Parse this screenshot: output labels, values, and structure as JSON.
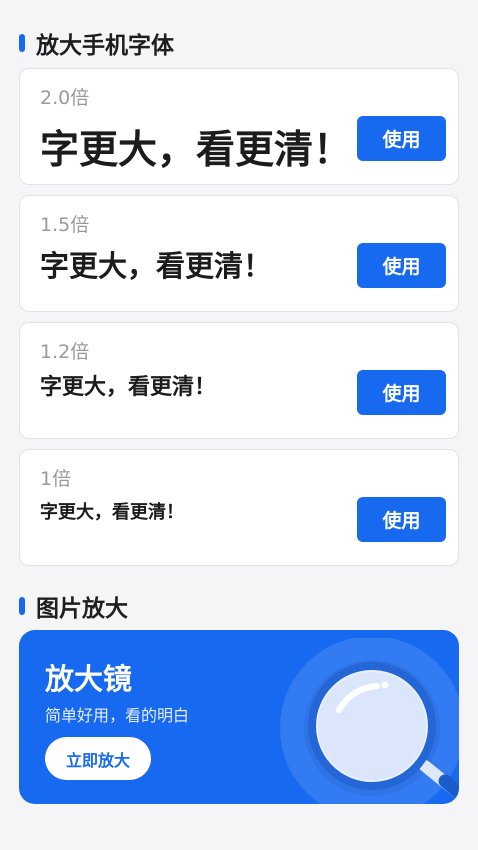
{
  "font_section": {
    "title": "放大手机字体",
    "options": [
      {
        "scale": "2.0倍",
        "sample": "字更大，看更清！",
        "button": "使用"
      },
      {
        "scale": "1.5倍",
        "sample": "字更大，看更清！",
        "button": "使用"
      },
      {
        "scale": "1.2倍",
        "sample": "字更大，看更清！",
        "button": "使用"
      },
      {
        "scale": "1倍",
        "sample": "字更大，看更清！",
        "button": "使用"
      }
    ]
  },
  "image_section": {
    "title": "图片放大",
    "banner": {
      "title": "放大镜",
      "subtitle": "简单好用，看的明白",
      "button": "立即放大"
    }
  },
  "colors": {
    "accent": "#1769f0",
    "page_bg": "#f5f5f7",
    "card_bg": "#ffffff",
    "muted_text": "#9a9a9a"
  },
  "icons": {
    "banner_illustration": "magnifier-icon"
  }
}
